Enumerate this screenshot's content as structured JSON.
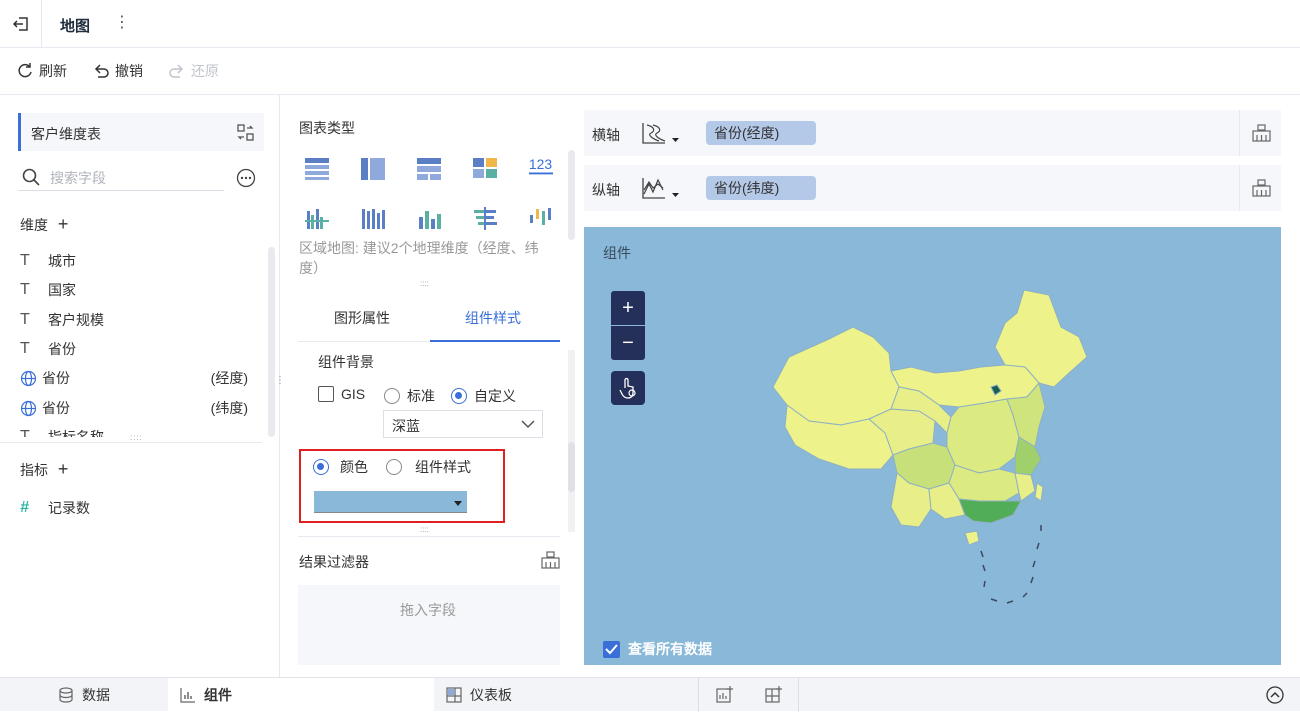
{
  "header": {
    "title": "地图",
    "more_glyph": "⋮"
  },
  "toolbar": {
    "refresh": "刷新",
    "undo": "撤销",
    "redo": "还原"
  },
  "left": {
    "table_name": "客户维度表",
    "search_placeholder": "搜索字段",
    "dimensions_label": "维度",
    "dimensions": [
      {
        "name": "城市",
        "icon": "text-icon",
        "suffix": ""
      },
      {
        "name": "国家",
        "icon": "text-icon",
        "suffix": ""
      },
      {
        "name": "客户规模",
        "icon": "text-icon",
        "suffix": ""
      },
      {
        "name": "省份",
        "icon": "text-icon",
        "suffix": ""
      },
      {
        "name": "省份",
        "icon": "globe-icon",
        "suffix": "(经度)"
      },
      {
        "name": "省份",
        "icon": "globe-icon",
        "suffix": "(纬度)"
      },
      {
        "name": "指标名称",
        "icon": "text-icon",
        "suffix": ""
      }
    ],
    "measures_label": "指标",
    "measures": [
      {
        "name": "记录数",
        "icon": "number-icon"
      }
    ]
  },
  "middle": {
    "chart_type_title": "图表类型",
    "chart_hint": "区域地图: 建议2个地理维度（经度、纬度）",
    "tabs": [
      "图形属性",
      "组件样式"
    ],
    "active_tab": 1,
    "bg_section_title": "组件背景",
    "gis_label": "GIS",
    "radio_standard": "标准",
    "radio_custom": "自定义",
    "theme_select": "深蓝",
    "radio_color": "颜色",
    "radio_component_style": "组件样式",
    "color_value": "#89b8d8",
    "filter_title": "结果过滤器",
    "filter_placeholder": "拖入字段",
    "number_icon_text": "123"
  },
  "right": {
    "x_axis_label": "横轴",
    "y_axis_label": "纵轴",
    "x_field": "省份(经度)",
    "y_field": "省份(纬度)",
    "map_title": "组件",
    "zoom_in": "+",
    "zoom_out": "−",
    "view_all_label": "查看所有数据",
    "map_bg_color": "#89b8d8"
  },
  "bottom": {
    "tab_data": "数据",
    "tab_component": "组件",
    "tab_dashboard": "仪表板"
  }
}
